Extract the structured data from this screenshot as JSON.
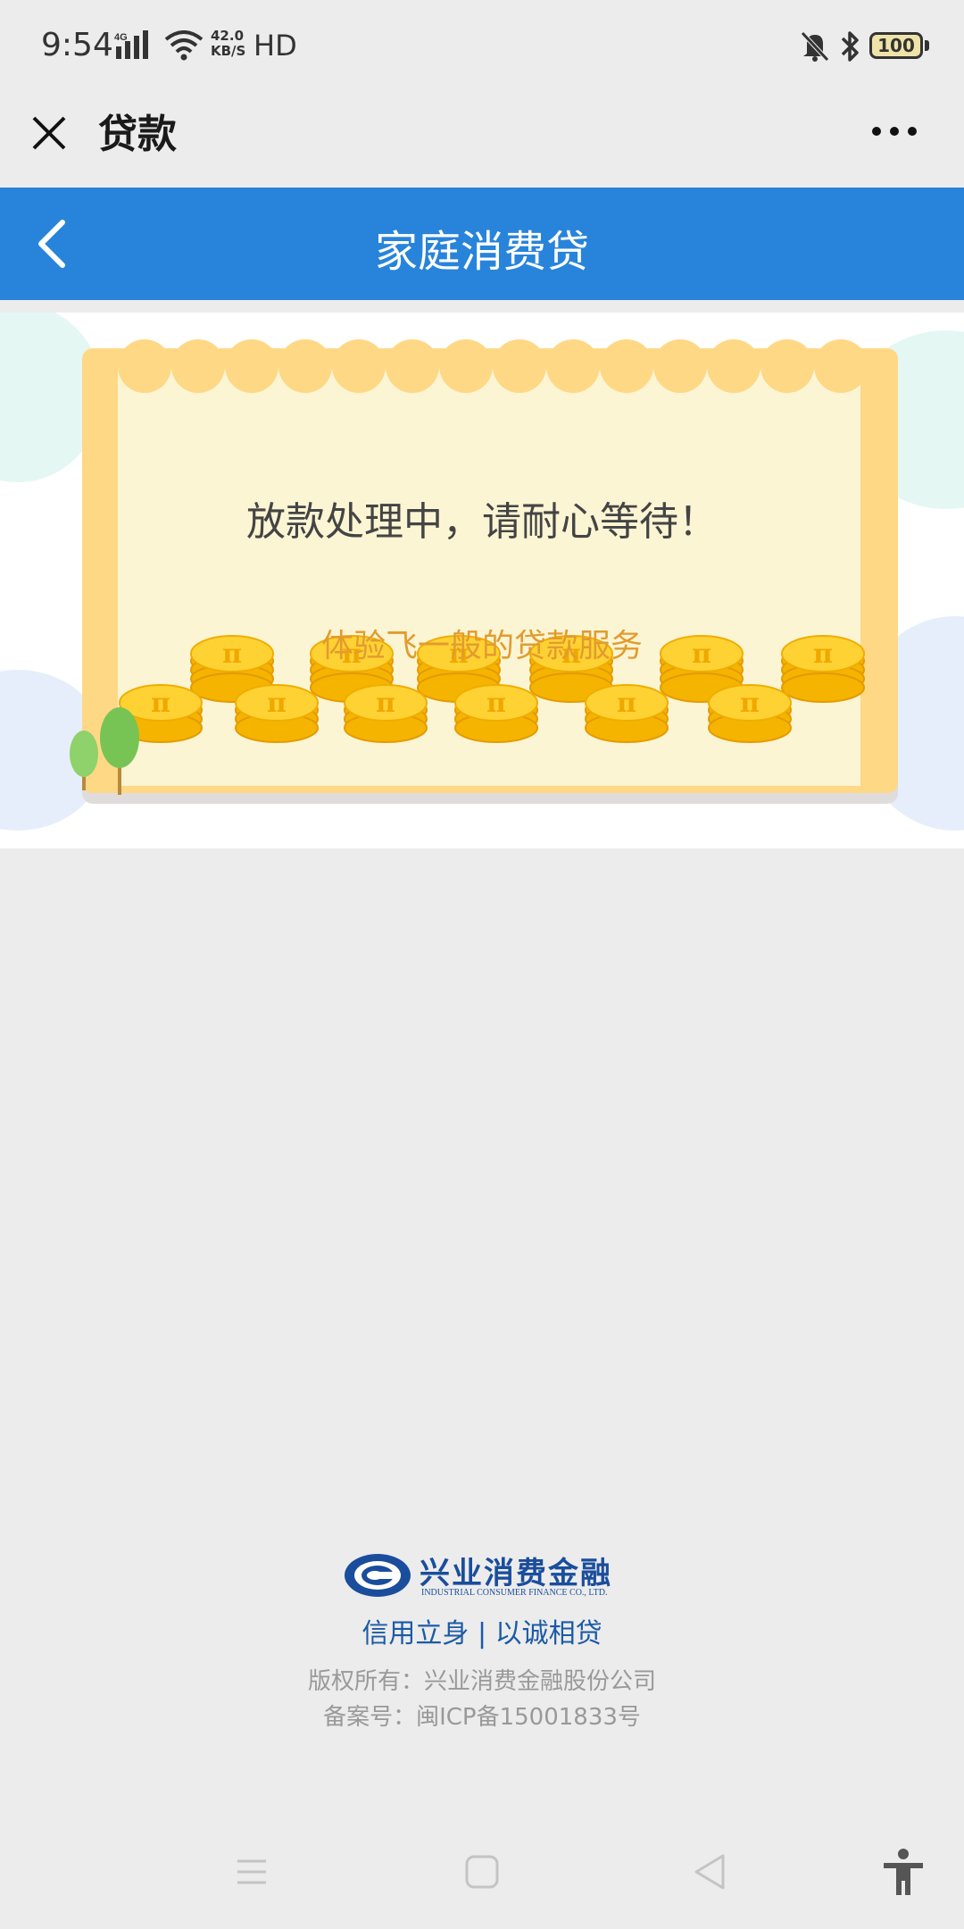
{
  "status_bar": {
    "time": "9:54",
    "network": "4G",
    "speed_value": "42.0",
    "speed_unit": "KB/S",
    "hd": "HD",
    "battery": "100",
    "icons": [
      "signal-icon",
      "wifi-icon",
      "mute-icon",
      "bluetooth-icon",
      "battery-icon"
    ]
  },
  "app_header": {
    "title": "贷款",
    "close_icon": "close-icon",
    "more_icon": "more-icon"
  },
  "nav": {
    "title": "家庭消费贷",
    "back_icon": "back-chevron-icon"
  },
  "banner": {
    "main_text": "放款处理中，请耐心等待！",
    "sub_text": "体验飞一般的贷款服务",
    "coin_symbol": "π"
  },
  "footer": {
    "logo_cn": "兴业消费金融",
    "logo_en": "INDUSTRIAL CONSUMER FINANCE CO., LTD.",
    "slogan": "信用立身 | 以诚相贷",
    "copyright": "版权所有：兴业消费金融股份公司",
    "icp": "备案号：闽ICP备15001833号"
  },
  "system_nav": [
    "menu-icon",
    "home-icon",
    "back-icon",
    "accessibility-icon"
  ],
  "colors": {
    "nav_blue": "#2884da",
    "banner_frame": "#ffd885",
    "banner_inner": "#fbf5d4",
    "sub_text": "#e39b2e",
    "brand_blue": "#1a4d9c"
  }
}
